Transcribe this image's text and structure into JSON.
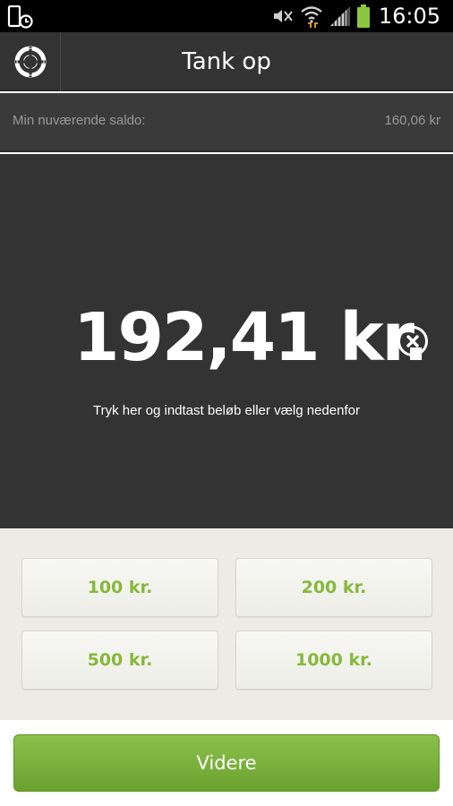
{
  "status_bar": {
    "time": "16:05",
    "icons": [
      "screenshot-icon",
      "mute-icon",
      "wifi-icon",
      "signal-icon",
      "battery-icon"
    ]
  },
  "app_bar": {
    "title": "Tank op",
    "menu_icon": "lifebuoy-icon"
  },
  "balance": {
    "label": "Min nuværende saldo:",
    "value": "160,06 kr"
  },
  "amount": {
    "value": "192,41 kr.",
    "hint": "Tryk her og indtast beløb eller vælg nedenfor",
    "clear_icon": "clear-icon"
  },
  "presets": [
    {
      "label": "100 kr."
    },
    {
      "label": "200 kr."
    },
    {
      "label": "500 kr."
    },
    {
      "label": "1000 kr."
    }
  ],
  "footer": {
    "next_label": "Videre"
  },
  "colors": {
    "accent_green": "#86b83a",
    "button_green": "#7ab33e",
    "dark_bg": "#333333",
    "preset_bg": "#ecebe5"
  }
}
